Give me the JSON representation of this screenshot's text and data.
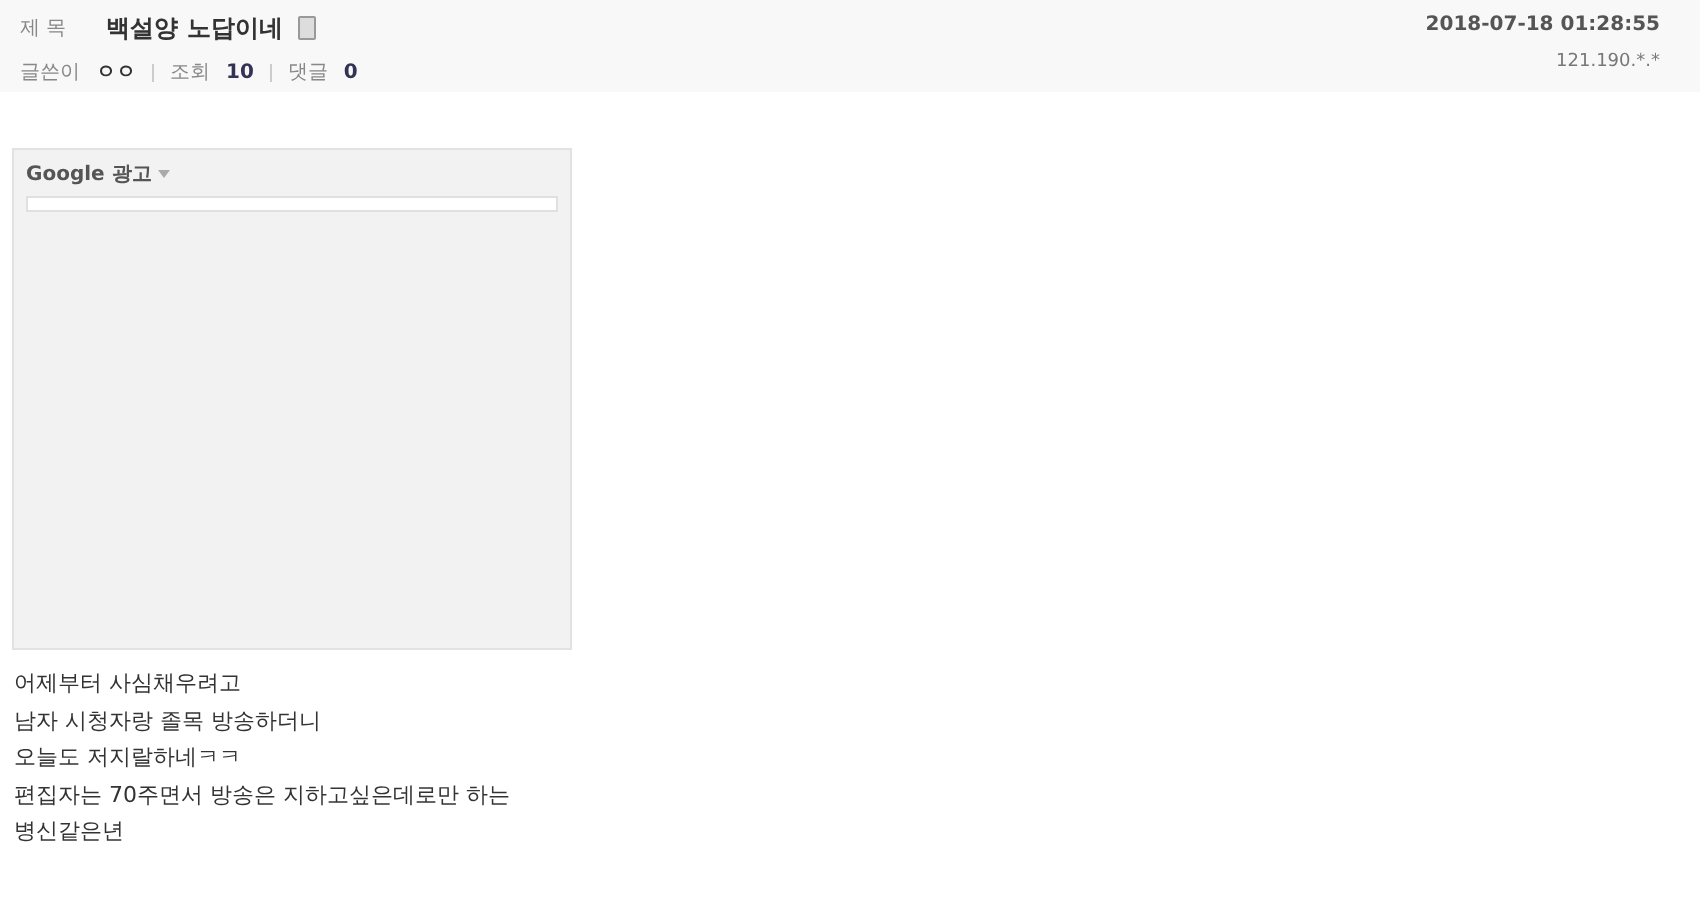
{
  "header": {
    "subject_label": "제 목",
    "title": "백설양 노답이네",
    "date": "2018-07-18 01:28:55",
    "meta": [
      {
        "label": "글쓴이",
        "value": "ㅇㅇ"
      },
      {
        "label": "조회",
        "value": "10"
      },
      {
        "label": "댓글",
        "value": "0"
      }
    ],
    "ip": "121.190.*.*"
  },
  "ad": {
    "label": "Google 광고"
  },
  "body": [
    "어제부터 사심채우려고",
    "남자 시청자랑 졸목 방송하더니",
    "오늘도 저지랄하네ㅋㅋ",
    "편집자는 70주면서 방송은 지하고싶은데로만 하는",
    "병신같은년"
  ]
}
